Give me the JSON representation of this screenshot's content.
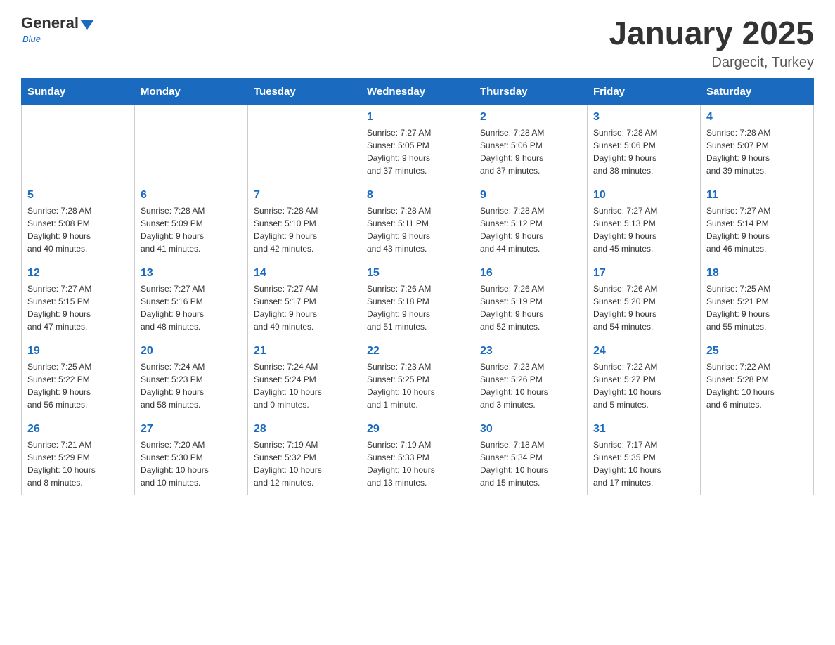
{
  "logo": {
    "general": "General",
    "blue": "Blue",
    "tagline": "Blue"
  },
  "title": "January 2025",
  "subtitle": "Dargecit, Turkey",
  "weekdays": [
    "Sunday",
    "Monday",
    "Tuesday",
    "Wednesday",
    "Thursday",
    "Friday",
    "Saturday"
  ],
  "weeks": [
    [
      {
        "day": "",
        "info": ""
      },
      {
        "day": "",
        "info": ""
      },
      {
        "day": "",
        "info": ""
      },
      {
        "day": "1",
        "info": "Sunrise: 7:27 AM\nSunset: 5:05 PM\nDaylight: 9 hours\nand 37 minutes."
      },
      {
        "day": "2",
        "info": "Sunrise: 7:28 AM\nSunset: 5:06 PM\nDaylight: 9 hours\nand 37 minutes."
      },
      {
        "day": "3",
        "info": "Sunrise: 7:28 AM\nSunset: 5:06 PM\nDaylight: 9 hours\nand 38 minutes."
      },
      {
        "day": "4",
        "info": "Sunrise: 7:28 AM\nSunset: 5:07 PM\nDaylight: 9 hours\nand 39 minutes."
      }
    ],
    [
      {
        "day": "5",
        "info": "Sunrise: 7:28 AM\nSunset: 5:08 PM\nDaylight: 9 hours\nand 40 minutes."
      },
      {
        "day": "6",
        "info": "Sunrise: 7:28 AM\nSunset: 5:09 PM\nDaylight: 9 hours\nand 41 minutes."
      },
      {
        "day": "7",
        "info": "Sunrise: 7:28 AM\nSunset: 5:10 PM\nDaylight: 9 hours\nand 42 minutes."
      },
      {
        "day": "8",
        "info": "Sunrise: 7:28 AM\nSunset: 5:11 PM\nDaylight: 9 hours\nand 43 minutes."
      },
      {
        "day": "9",
        "info": "Sunrise: 7:28 AM\nSunset: 5:12 PM\nDaylight: 9 hours\nand 44 minutes."
      },
      {
        "day": "10",
        "info": "Sunrise: 7:27 AM\nSunset: 5:13 PM\nDaylight: 9 hours\nand 45 minutes."
      },
      {
        "day": "11",
        "info": "Sunrise: 7:27 AM\nSunset: 5:14 PM\nDaylight: 9 hours\nand 46 minutes."
      }
    ],
    [
      {
        "day": "12",
        "info": "Sunrise: 7:27 AM\nSunset: 5:15 PM\nDaylight: 9 hours\nand 47 minutes."
      },
      {
        "day": "13",
        "info": "Sunrise: 7:27 AM\nSunset: 5:16 PM\nDaylight: 9 hours\nand 48 minutes."
      },
      {
        "day": "14",
        "info": "Sunrise: 7:27 AM\nSunset: 5:17 PM\nDaylight: 9 hours\nand 49 minutes."
      },
      {
        "day": "15",
        "info": "Sunrise: 7:26 AM\nSunset: 5:18 PM\nDaylight: 9 hours\nand 51 minutes."
      },
      {
        "day": "16",
        "info": "Sunrise: 7:26 AM\nSunset: 5:19 PM\nDaylight: 9 hours\nand 52 minutes."
      },
      {
        "day": "17",
        "info": "Sunrise: 7:26 AM\nSunset: 5:20 PM\nDaylight: 9 hours\nand 54 minutes."
      },
      {
        "day": "18",
        "info": "Sunrise: 7:25 AM\nSunset: 5:21 PM\nDaylight: 9 hours\nand 55 minutes."
      }
    ],
    [
      {
        "day": "19",
        "info": "Sunrise: 7:25 AM\nSunset: 5:22 PM\nDaylight: 9 hours\nand 56 minutes."
      },
      {
        "day": "20",
        "info": "Sunrise: 7:24 AM\nSunset: 5:23 PM\nDaylight: 9 hours\nand 58 minutes."
      },
      {
        "day": "21",
        "info": "Sunrise: 7:24 AM\nSunset: 5:24 PM\nDaylight: 10 hours\nand 0 minutes."
      },
      {
        "day": "22",
        "info": "Sunrise: 7:23 AM\nSunset: 5:25 PM\nDaylight: 10 hours\nand 1 minute."
      },
      {
        "day": "23",
        "info": "Sunrise: 7:23 AM\nSunset: 5:26 PM\nDaylight: 10 hours\nand 3 minutes."
      },
      {
        "day": "24",
        "info": "Sunrise: 7:22 AM\nSunset: 5:27 PM\nDaylight: 10 hours\nand 5 minutes."
      },
      {
        "day": "25",
        "info": "Sunrise: 7:22 AM\nSunset: 5:28 PM\nDaylight: 10 hours\nand 6 minutes."
      }
    ],
    [
      {
        "day": "26",
        "info": "Sunrise: 7:21 AM\nSunset: 5:29 PM\nDaylight: 10 hours\nand 8 minutes."
      },
      {
        "day": "27",
        "info": "Sunrise: 7:20 AM\nSunset: 5:30 PM\nDaylight: 10 hours\nand 10 minutes."
      },
      {
        "day": "28",
        "info": "Sunrise: 7:19 AM\nSunset: 5:32 PM\nDaylight: 10 hours\nand 12 minutes."
      },
      {
        "day": "29",
        "info": "Sunrise: 7:19 AM\nSunset: 5:33 PM\nDaylight: 10 hours\nand 13 minutes."
      },
      {
        "day": "30",
        "info": "Sunrise: 7:18 AM\nSunset: 5:34 PM\nDaylight: 10 hours\nand 15 minutes."
      },
      {
        "day": "31",
        "info": "Sunrise: 7:17 AM\nSunset: 5:35 PM\nDaylight: 10 hours\nand 17 minutes."
      },
      {
        "day": "",
        "info": ""
      }
    ]
  ]
}
